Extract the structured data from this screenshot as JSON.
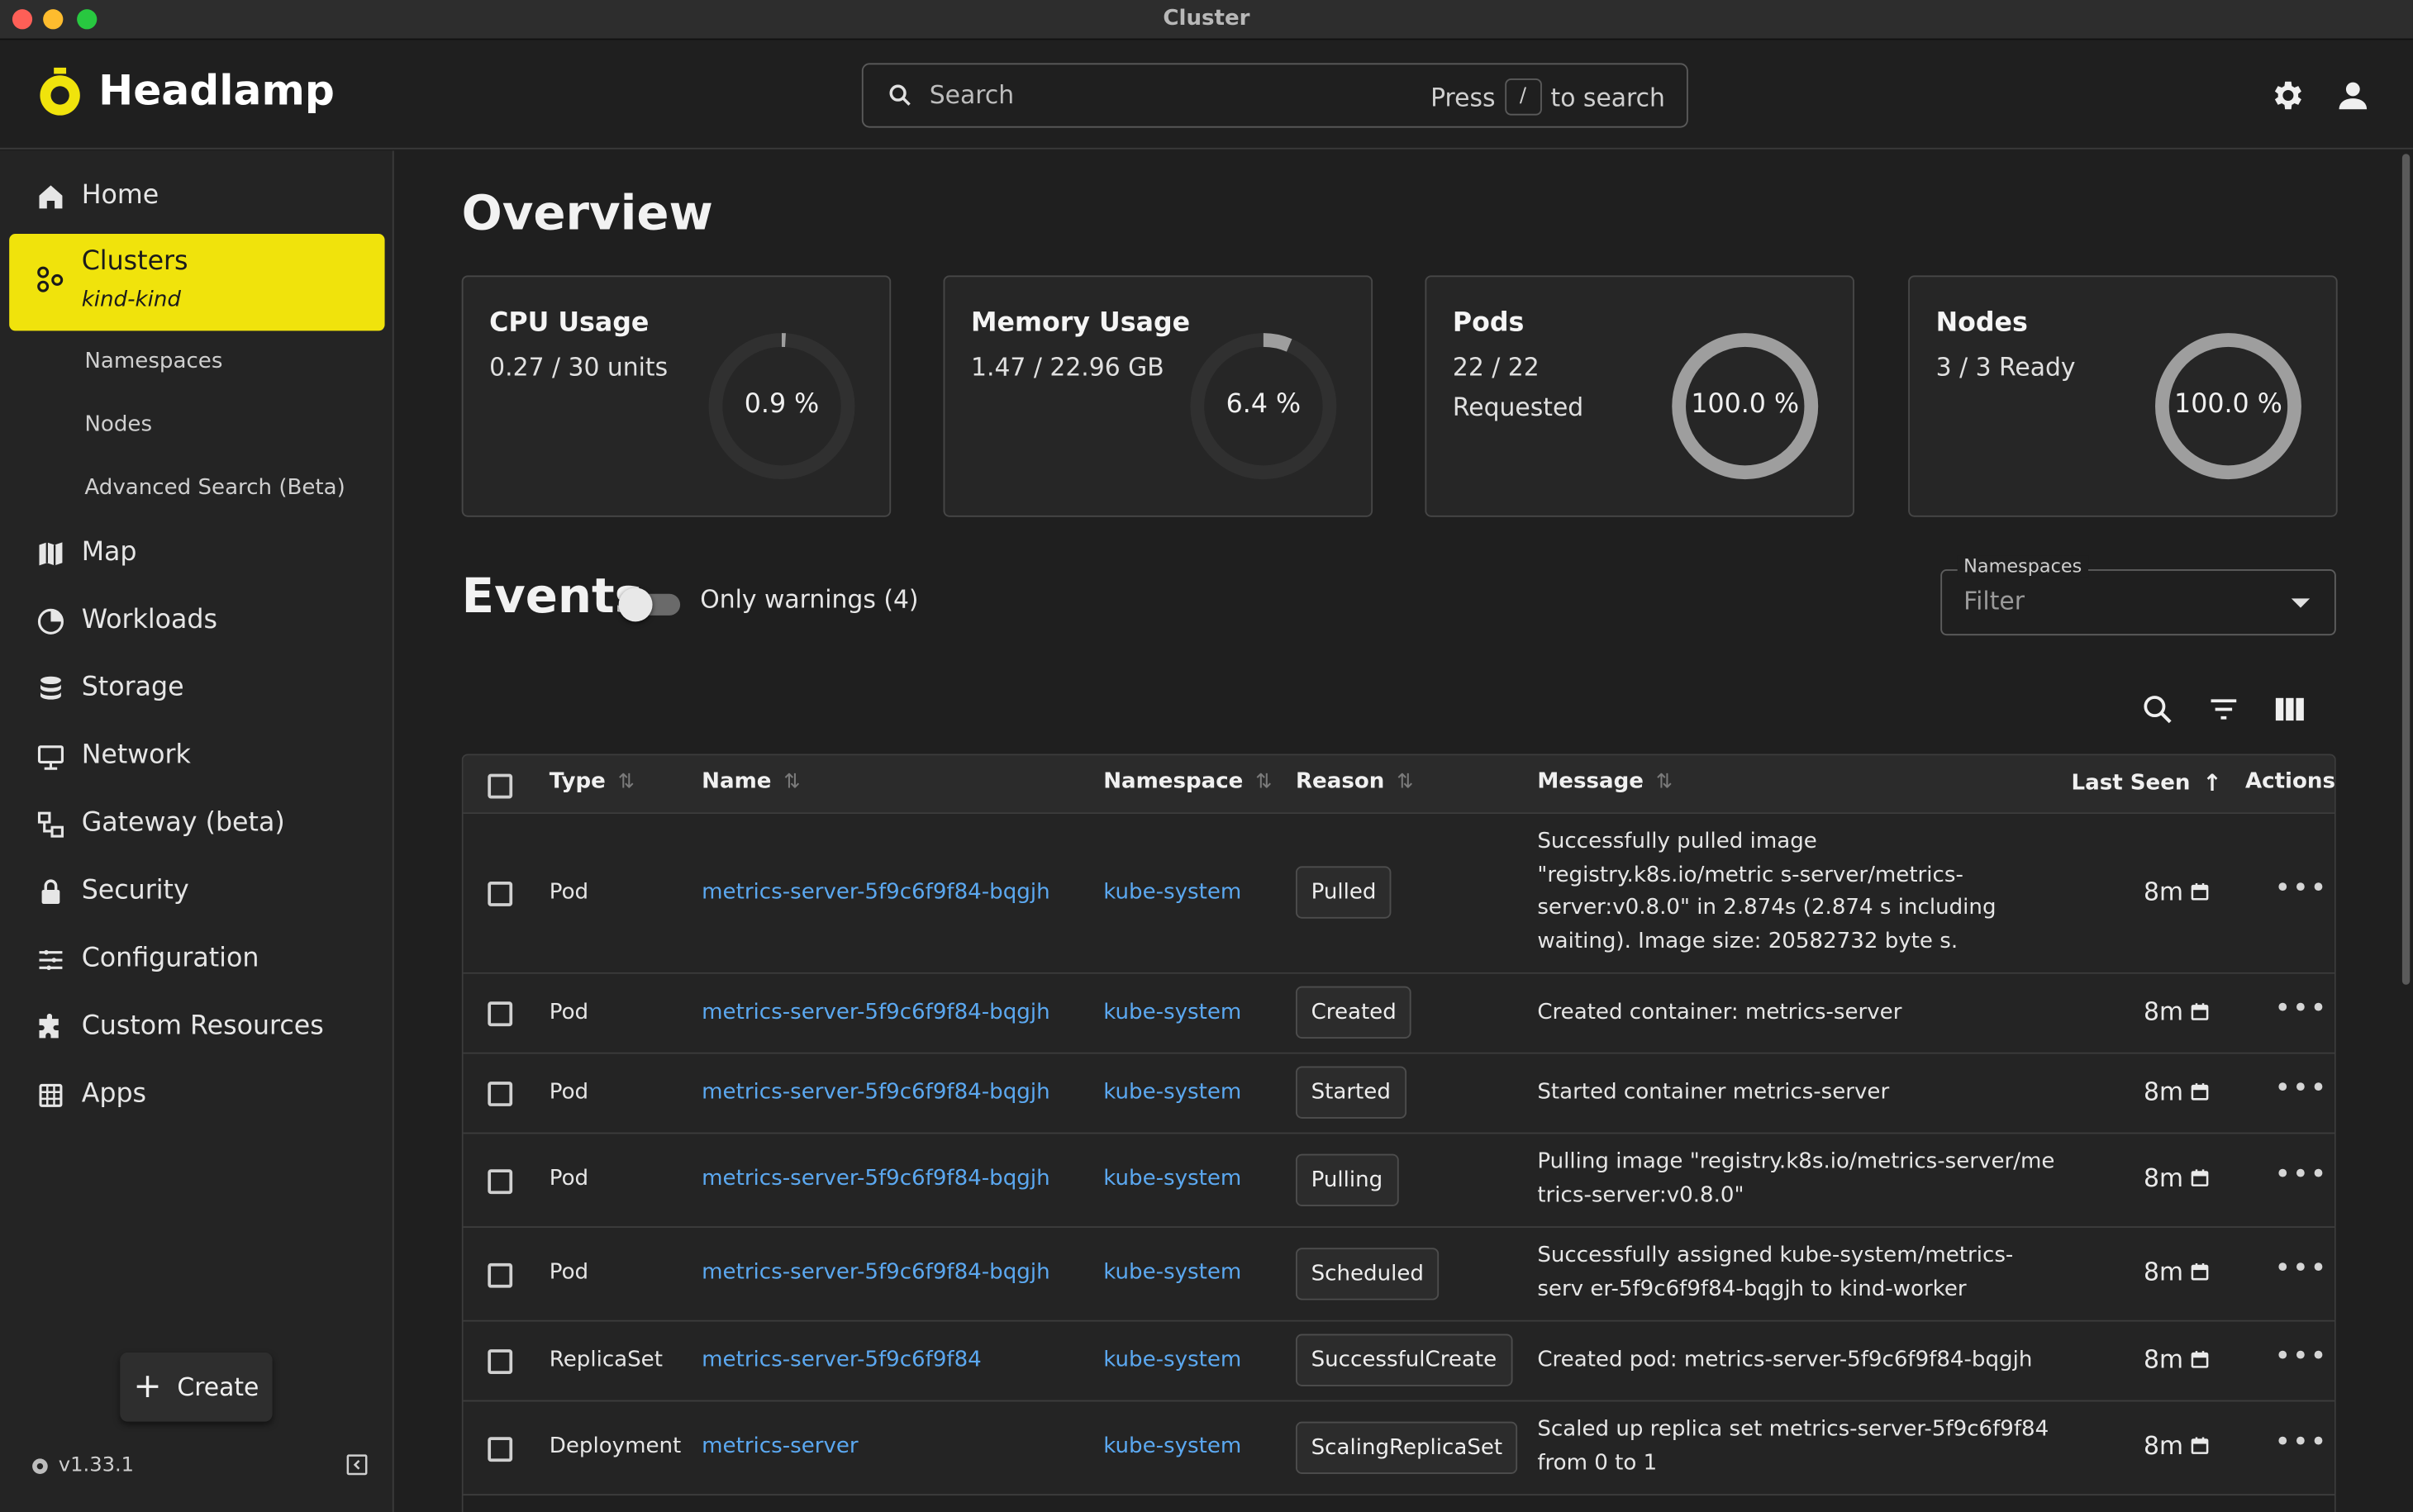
{
  "window": {
    "title": "Cluster"
  },
  "appbar": {
    "brand": "Headlamp",
    "search_placeholder": "Search",
    "search_hint_prefix": "Press",
    "search_hint_key": "/",
    "search_hint_suffix": "to search"
  },
  "sidebar": {
    "home": "Home",
    "clusters": "Clusters",
    "cluster_name": "kind-kind",
    "namespaces": "Namespaces",
    "nodes": "Nodes",
    "advanced_search": "Advanced Search (Beta)",
    "map": "Map",
    "workloads": "Workloads",
    "storage": "Storage",
    "network": "Network",
    "gateway": "Gateway (beta)",
    "security": "Security",
    "configuration": "Configuration",
    "custom_resources": "Custom Resources",
    "apps": "Apps",
    "create": "Create",
    "version": "v1.33.1"
  },
  "overview": {
    "title": "Overview",
    "cards": [
      {
        "title": "CPU Usage",
        "value_line1": "0.27 / 30 units",
        "value_line2": "",
        "percent_label": "0.9 %",
        "percent": 0.9
      },
      {
        "title": "Memory Usage",
        "value_line1": "1.47 / 22.96 GB",
        "value_line2": "",
        "percent_label": "6.4 %",
        "percent": 6.4
      },
      {
        "title": "Pods",
        "value_line1": "22 / 22",
        "value_line2": "Requested",
        "percent_label": "100.0 %",
        "percent": 100
      },
      {
        "title": "Nodes",
        "value_line1": "3 / 3 Ready",
        "value_line2": "",
        "percent_label": "100.0 %",
        "percent": 100
      }
    ]
  },
  "events": {
    "title": "Events",
    "only_warnings": "Only warnings (4)",
    "only_warnings_on": false,
    "ns_label": "Namespaces",
    "ns_placeholder": "Filter",
    "columns": {
      "type": "Type",
      "name": "Name",
      "namespace": "Namespace",
      "reason": "Reason",
      "message": "Message",
      "last_seen": "Last Seen",
      "actions": "Actions"
    },
    "rows": [
      {
        "type": "Pod",
        "name": "metrics-server-5f9c6f9f84-bqgjh",
        "namespace": "kube-system",
        "reason": "Pulled",
        "message": "Successfully pulled image \"registry.k8s.io/metric s-server/metrics-server:v0.8.0\" in 2.874s (2.874 s including waiting). Image size: 20582732 byte s.",
        "last_seen": "8m"
      },
      {
        "type": "Pod",
        "name": "metrics-server-5f9c6f9f84-bqgjh",
        "namespace": "kube-system",
        "reason": "Created",
        "message": "Created container: metrics-server",
        "last_seen": "8m"
      },
      {
        "type": "Pod",
        "name": "metrics-server-5f9c6f9f84-bqgjh",
        "namespace": "kube-system",
        "reason": "Started",
        "message": "Started container metrics-server",
        "last_seen": "8m"
      },
      {
        "type": "Pod",
        "name": "metrics-server-5f9c6f9f84-bqgjh",
        "namespace": "kube-system",
        "reason": "Pulling",
        "message": "Pulling image \"registry.k8s.io/metrics-server/me trics-server:v0.8.0\"",
        "last_seen": "8m"
      },
      {
        "type": "Pod",
        "name": "metrics-server-5f9c6f9f84-bqgjh",
        "namespace": "kube-system",
        "reason": "Scheduled",
        "message": "Successfully assigned kube-system/metrics-serv er-5f9c6f9f84-bqgjh to kind-worker",
        "last_seen": "8m"
      },
      {
        "type": "ReplicaSet",
        "name": "metrics-server-5f9c6f9f84",
        "namespace": "kube-system",
        "reason": "SuccessfulCreate",
        "message": "Created pod: metrics-server-5f9c6f9f84-bqgjh",
        "last_seen": "8m"
      },
      {
        "type": "Deployment",
        "name": "metrics-server",
        "namespace": "kube-system",
        "reason": "ScalingReplicaSet",
        "message": "Scaled up replica set metrics-server-5f9c6f9f84 from 0 to 1",
        "last_seen": "8m"
      }
    ]
  },
  "colors": {
    "accent": "#f0e30c",
    "link": "#5ba8f0",
    "background": "#1f1f1f"
  }
}
